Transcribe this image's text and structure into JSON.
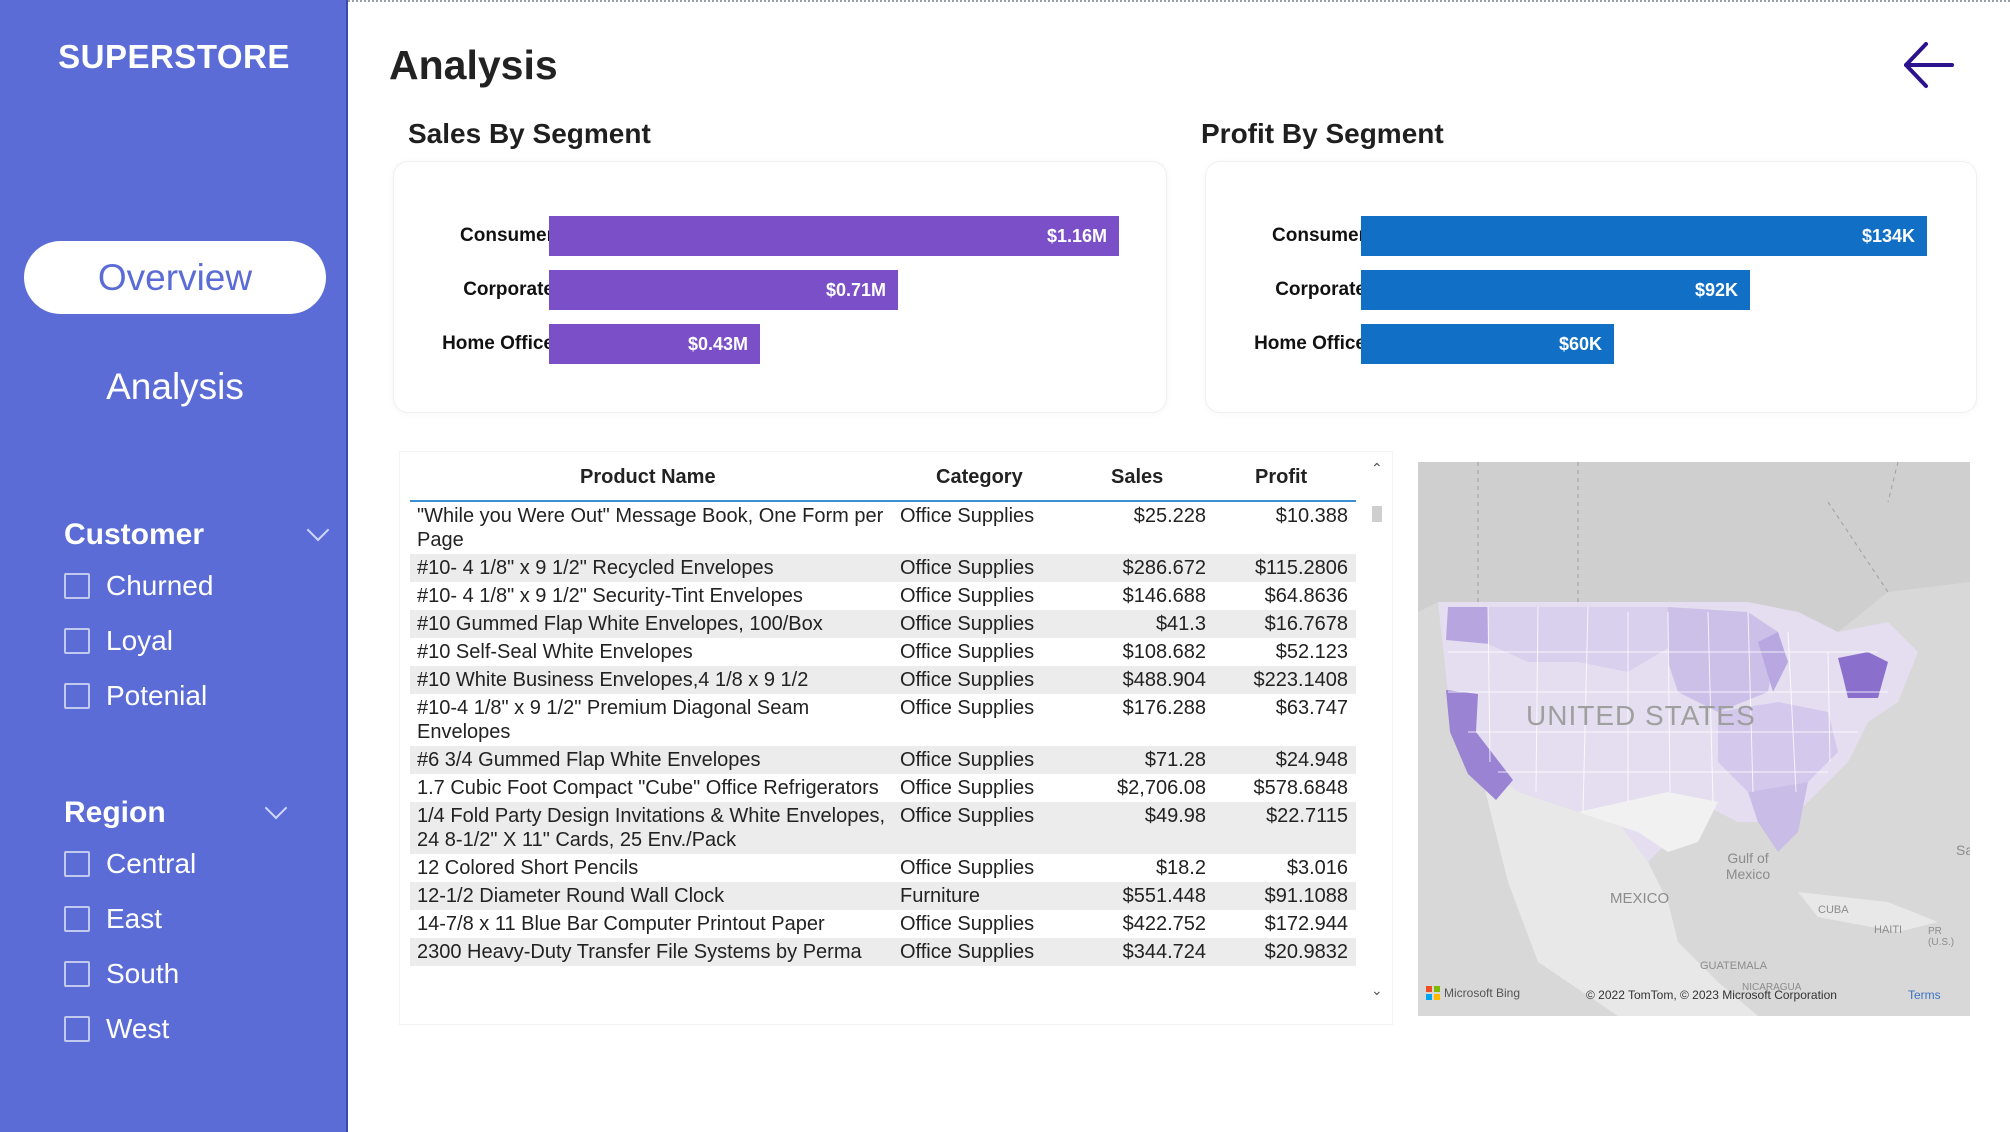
{
  "app": {
    "brand": "SUPERSTORE",
    "page_title": "Analysis"
  },
  "nav": {
    "overview": "Overview",
    "analysis": "Analysis"
  },
  "customer_slicer": {
    "title": "Customer",
    "options": [
      "Churned",
      "Loyal",
      "Potenial"
    ]
  },
  "region_slicer": {
    "title": "Region",
    "options": [
      "Central",
      "East",
      "South",
      "West"
    ]
  },
  "colors": {
    "sidebar": "#5b6cd6",
    "sales_bar": "#7a4fc7",
    "profit_bar": "#1170c5",
    "table_header_rule": "#3d8fd3"
  },
  "sales_chart": {
    "title": "Sales By Segment",
    "chart_data": {
      "type": "bar",
      "orientation": "horizontal",
      "categories": [
        "Consumer",
        "Corporate",
        "Home Office"
      ],
      "values": [
        1.16,
        0.71,
        0.43
      ],
      "value_unit": "$M",
      "data_labels": [
        "$1.16M",
        "$0.71M",
        "$0.43M"
      ]
    }
  },
  "profit_chart": {
    "title": "Profit By Segment",
    "chart_data": {
      "type": "bar",
      "orientation": "horizontal",
      "categories": [
        "Consumer",
        "Corporate",
        "Home Office"
      ],
      "values": [
        134,
        92,
        60
      ],
      "value_unit": "$K",
      "data_labels": [
        "$134K",
        "$92K",
        "$60K"
      ]
    }
  },
  "table": {
    "columns": [
      "Product Name",
      "Category",
      "Sales",
      "Profit"
    ],
    "rows": [
      [
        "\"While you Were Out\" Message Book, One Form per Page",
        "Office Supplies",
        "$25.228",
        "$10.388"
      ],
      [
        "#10- 4 1/8\" x 9 1/2\" Recycled Envelopes",
        "Office Supplies",
        "$286.672",
        "$115.2806"
      ],
      [
        "#10- 4 1/8\" x 9 1/2\" Security-Tint Envelopes",
        "Office Supplies",
        "$146.688",
        "$64.8636"
      ],
      [
        "#10 Gummed Flap White Envelopes, 100/Box",
        "Office Supplies",
        "$41.3",
        "$16.7678"
      ],
      [
        "#10 Self-Seal White Envelopes",
        "Office Supplies",
        "$108.682",
        "$52.123"
      ],
      [
        "#10 White Business Envelopes,4 1/8 x 9 1/2",
        "Office Supplies",
        "$488.904",
        "$223.1408"
      ],
      [
        "#10-4 1/8\" x 9 1/2\" Premium Diagonal Seam Envelopes",
        "Office Supplies",
        "$176.288",
        "$63.747"
      ],
      [
        "#6 3/4 Gummed Flap White Envelopes",
        "Office Supplies",
        "$71.28",
        "$24.948"
      ],
      [
        "1.7 Cubic Foot Compact \"Cube\" Office Refrigerators",
        "Office Supplies",
        "$2,706.08",
        "$578.6848"
      ],
      [
        "1/4 Fold Party Design Invitations & White Envelopes, 24 8-1/2\" X 11\" Cards, 25 Env./Pack",
        "Office Supplies",
        "$49.98",
        "$22.7115"
      ],
      [
        "12 Colored Short Pencils",
        "Office Supplies",
        "$18.2",
        "$3.016"
      ],
      [
        "12-1/2 Diameter Round Wall Clock",
        "Furniture",
        "$551.448",
        "$91.1088"
      ],
      [
        "14-7/8 x 11 Blue Bar Computer Printout Paper",
        "Office Supplies",
        "$422.752",
        "$172.944"
      ],
      [
        "2300 Heavy-Duty Transfer File Systems by Perma",
        "Office Supplies",
        "$344.724",
        "$20.9832"
      ]
    ]
  },
  "map": {
    "country_label": "UNITED STATES",
    "labels": [
      "MEXICO",
      "Gulf of Mexico",
      "CUBA",
      "HAITI",
      "PR (U.S.)",
      "GUATEMALA",
      "NICARAGUA",
      "Sa"
    ],
    "bing_text": "Microsoft Bing",
    "attribution": "© 2022 TomTom, © 2023 Microsoft Corporation",
    "terms": "Terms"
  }
}
